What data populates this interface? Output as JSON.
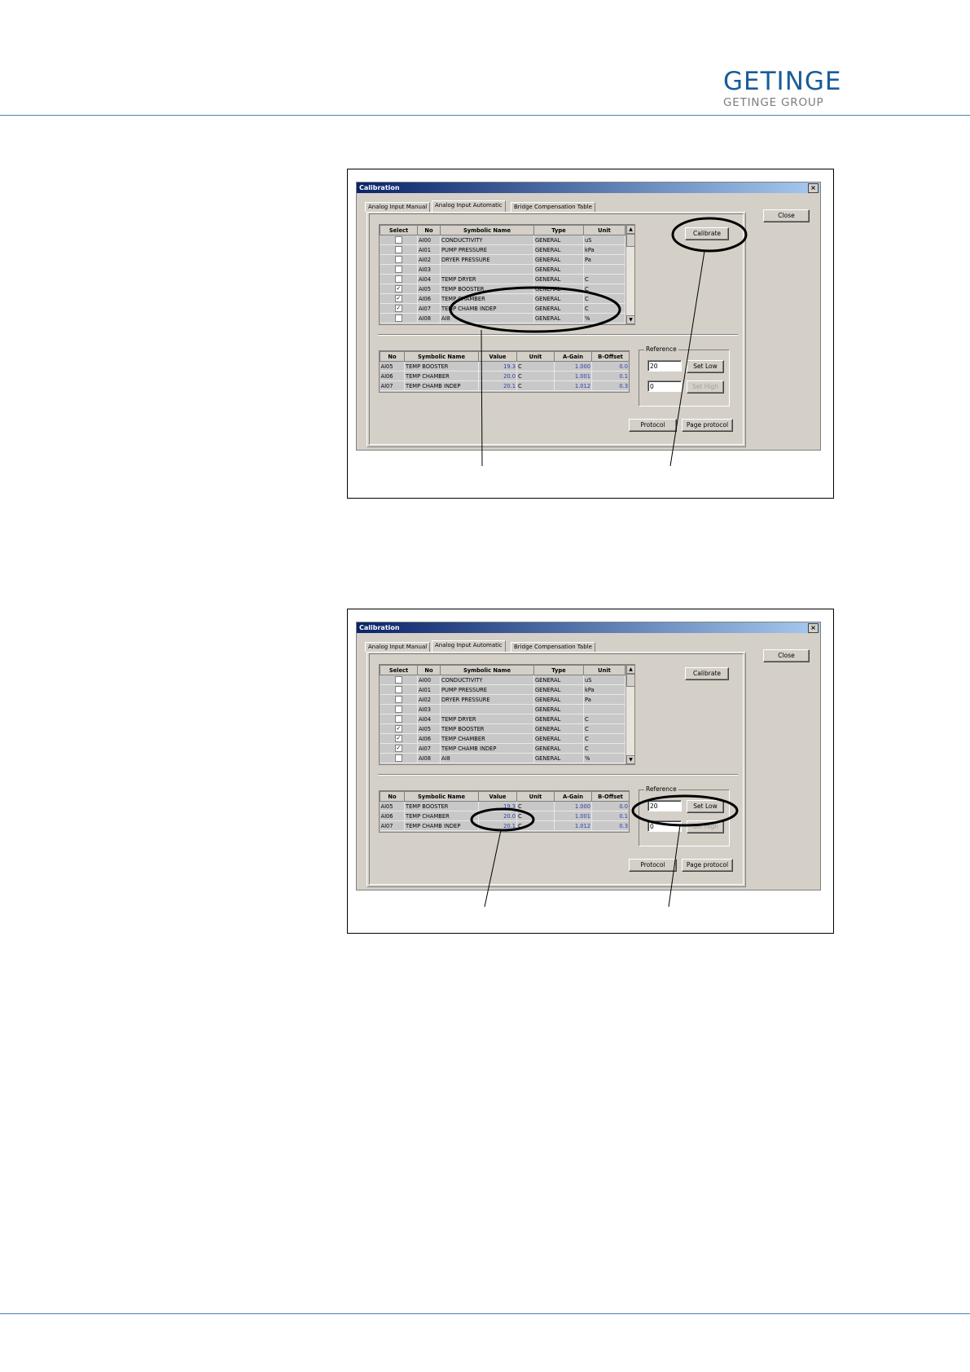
{
  "brand": {
    "name": "GETINGE",
    "group": "GETINGE GROUP"
  },
  "dialog": {
    "title": "Calibration",
    "close_x": "×",
    "tabs": [
      "Analog Input Manual",
      "Analog Input Automatic",
      "Bridge Compensation Table"
    ],
    "close_button": "Close",
    "calibrate_button": "Calibrate",
    "protocol_button": "Protocol",
    "page_protocol_button": "Page protocol",
    "reference_label": "Reference",
    "reference_low": "20",
    "reference_high": "0",
    "set_low": "Set Low",
    "set_high": "Set High",
    "input_columns": [
      "Select",
      "No",
      "Symbolic Name",
      "Type",
      "Unit"
    ],
    "inputs": [
      {
        "no": "AI00",
        "name": "CONDUCTIVITY",
        "type": "GENERAL",
        "unit": "uS",
        "selected": false
      },
      {
        "no": "AI01",
        "name": "PUMP PRESSURE",
        "type": "GENERAL",
        "unit": "kPa",
        "selected": false
      },
      {
        "no": "AI02",
        "name": "DRYER PRESSURE",
        "type": "GENERAL",
        "unit": "Pa",
        "selected": false
      },
      {
        "no": "AI03",
        "name": "",
        "type": "GENERAL",
        "unit": "",
        "selected": false
      },
      {
        "no": "AI04",
        "name": "TEMP DRYER",
        "type": "GENERAL",
        "unit": "C",
        "selected": false
      },
      {
        "no": "AI05",
        "name": "TEMP BOOSTER",
        "type": "GENERAL",
        "unit": "C",
        "selected": true
      },
      {
        "no": "AI06",
        "name": "TEMP CHAMBER",
        "type": "GENERAL",
        "unit": "C",
        "selected": true
      },
      {
        "no": "AI07",
        "name": "TEMP CHAMB INDEP",
        "type": "GENERAL",
        "unit": "C",
        "selected": true
      },
      {
        "no": "AI08",
        "name": "AI8",
        "type": "GENERAL",
        "unit": "%",
        "selected": false
      }
    ],
    "calib_columns": [
      "No",
      "Symbolic Name",
      "Value",
      "Unit",
      "A-Gain",
      "B-Offset"
    ],
    "calibration": [
      {
        "no": "AI05",
        "name": "TEMP BOOSTER",
        "value": "19.3",
        "unit": "C",
        "gain": "1.000",
        "offset": "0.0"
      },
      {
        "no": "AI06",
        "name": "TEMP CHAMBER",
        "value": "20.0",
        "unit": "C",
        "gain": "1.001",
        "offset": "0.1"
      },
      {
        "no": "AI07",
        "name": "TEMP CHAMB INDEP",
        "value": "20.1",
        "unit": "C",
        "gain": "1.012",
        "offset": "0.3"
      }
    ]
  }
}
